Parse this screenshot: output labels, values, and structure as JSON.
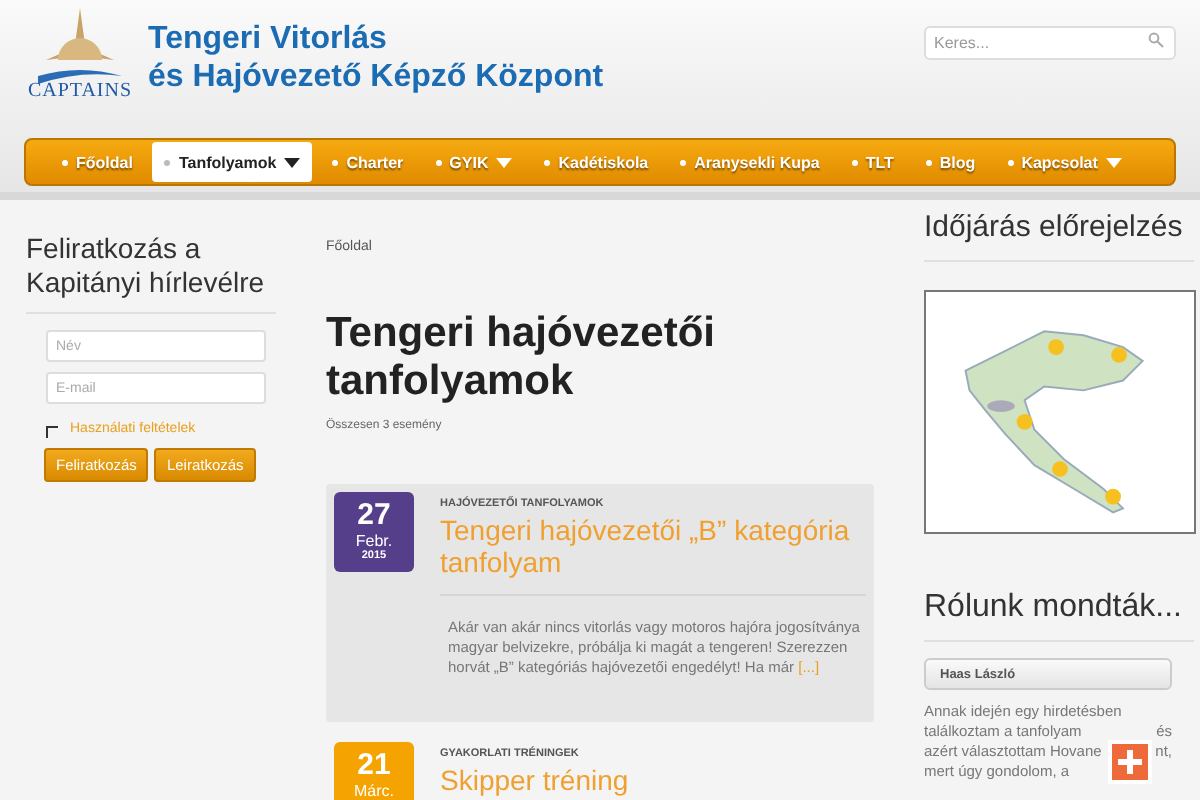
{
  "header": {
    "logo_text": "CAPTAINS",
    "title_lines": [
      "Tengeri Vitorlás",
      "és Hajóvezető Képző Központ"
    ],
    "search": {
      "placeholder": "Keres..."
    }
  },
  "nav": [
    {
      "label": "Főoldal",
      "selected": false,
      "has_menu": false
    },
    {
      "label": "Tanfolyamok",
      "selected": true,
      "has_menu": true
    },
    {
      "label": "Charter",
      "selected": false,
      "has_menu": false
    },
    {
      "label": "GYIK",
      "selected": false,
      "has_menu": true
    },
    {
      "label": "Kadétiskola",
      "selected": false,
      "has_menu": false
    },
    {
      "label": "Aranysekli Kupa",
      "selected": false,
      "has_menu": false
    },
    {
      "label": "TLT",
      "selected": false,
      "has_menu": false
    },
    {
      "label": "Blog",
      "selected": false,
      "has_menu": false
    },
    {
      "label": "Kapcsolat",
      "selected": false,
      "has_menu": true
    }
  ],
  "newsletter": {
    "title": "Feliratkozás a Kapitányi hírlevélre",
    "name_placeholder": "Név",
    "email_placeholder": "E-mail",
    "terms_checked": false,
    "terms_label": "Használati feltételek",
    "buttons": [
      "Feliratkozás",
      "Leiratkozás"
    ]
  },
  "content": {
    "breadcrumb": "Főoldal",
    "title": "Tengeri hajóvezetői tanfolyamok",
    "count": "Összesen 3 esemény",
    "events": [
      {
        "day": "27",
        "month": "Febr.",
        "year": "2015",
        "color": "#553f8a",
        "category": "HAJÓVEZETŐI TANFOLYAMOK",
        "title": "Tengeri hajóvezetői „B” kategória tanfolyam",
        "excerpt": "Akár van akár nincs vitorlás vagy motoros hajóra jogosítványa magyar belvizekre, próbálja ki magát a tengeren! Szerezzen horvát „B” kategóriás hajóvezetői engedélyt! Ha már",
        "more": "[...]"
      },
      {
        "day": "21",
        "month": "Márc.",
        "color": "#f5a300",
        "category": "GYAKORLATI TRÉNINGEK",
        "title": "Skipper tréning"
      }
    ]
  },
  "weather": {
    "title": "Időjárás előrejelzés"
  },
  "testimonials": {
    "title": "Rólunk mondták...",
    "author": "Haas László",
    "quote_lines": [
      {
        "text": "Annak idején egy hirdetésben"
      },
      {
        "text": "találkoztam a tanfolyam",
        "tail": "és"
      },
      {
        "text": "azért választottam Hovane",
        "tail": "nt,"
      },
      {
        "text": "mert úgy gondolom, a"
      }
    ]
  }
}
